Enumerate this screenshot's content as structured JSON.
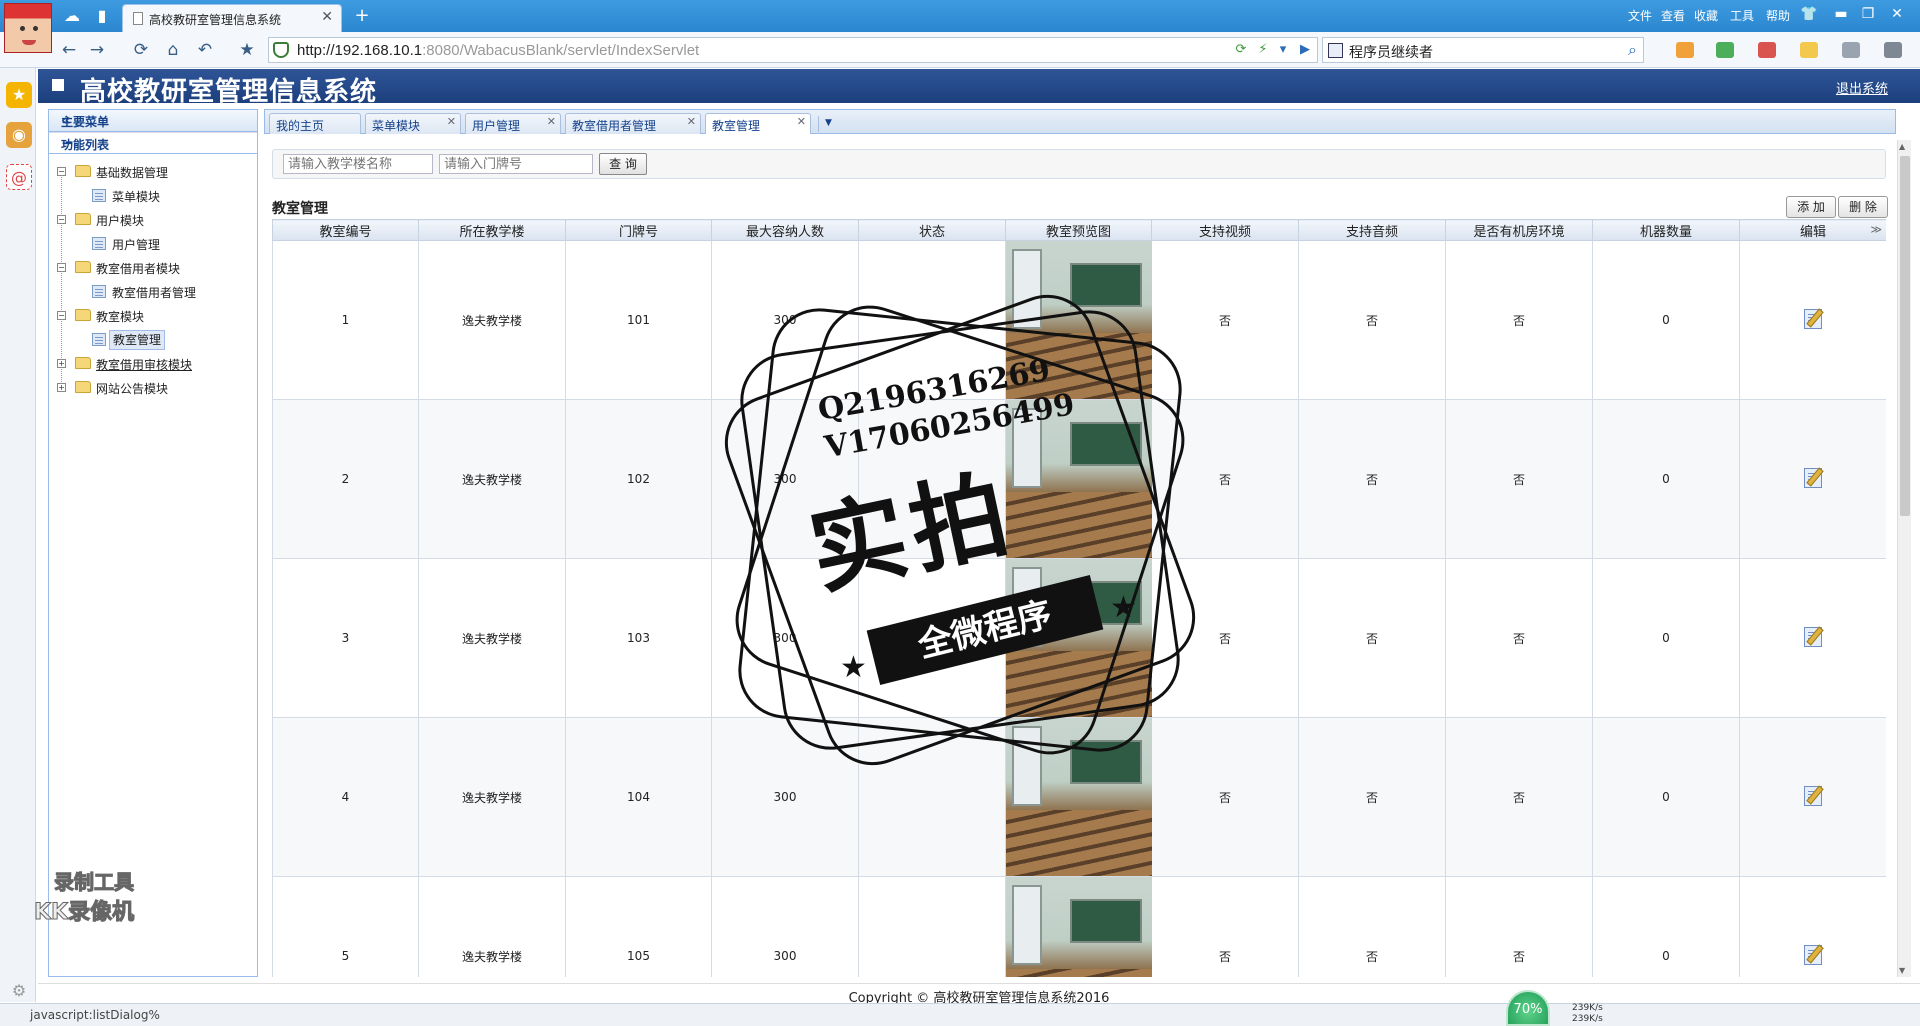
{
  "browser": {
    "tab_title": "高校教研室管理信息系统",
    "url_host": "http://192.168.10.1",
    "url_rest": ":8080/WabacusBlank/servlet/IndexServlet",
    "search_text": "程序员继续者",
    "menu": [
      "文件",
      "查看",
      "收藏",
      "工具",
      "帮助"
    ],
    "status_text": "javascript:listDialog%"
  },
  "app": {
    "title": "高校教研室管理信息系统",
    "logout": "退出系统",
    "footer": "Copyright © 高校教研室管理信息系统2016"
  },
  "sidebar": {
    "main_menu": "主要菜单",
    "function_list": "功能列表",
    "tree": [
      {
        "label": "基础数据管理",
        "level": 0,
        "expanded": true
      },
      {
        "label": "菜单模块",
        "level": 1
      },
      {
        "label": "用户模块",
        "level": 0,
        "expanded": true
      },
      {
        "label": "用户管理",
        "level": 1
      },
      {
        "label": "教室借用者模块",
        "level": 0,
        "expanded": true
      },
      {
        "label": "教室借用者管理",
        "level": 1
      },
      {
        "label": "教室模块",
        "level": 0,
        "expanded": true
      },
      {
        "label": "教室管理",
        "level": 1,
        "selected": true
      },
      {
        "label": "教室借用审核模块",
        "level": 0,
        "expanded": false
      },
      {
        "label": "网站公告模块",
        "level": 0,
        "expanded": false
      }
    ]
  },
  "tabs": [
    {
      "label": "我的主页",
      "closable": false
    },
    {
      "label": "菜单模块",
      "closable": true
    },
    {
      "label": "用户管理",
      "closable": true
    },
    {
      "label": "教室借用者管理",
      "closable": true
    },
    {
      "label": "教室管理",
      "closable": true,
      "active": true
    }
  ],
  "search": {
    "building_placeholder": "请输入教学楼名称",
    "room_placeholder": "请输入门牌号",
    "query_button": "查 询"
  },
  "section": {
    "title": "教室管理",
    "add_button": "添 加",
    "delete_button": "删 除"
  },
  "table": {
    "columns": [
      "教室编号",
      "所在教学楼",
      "门牌号",
      "最大容纳人数",
      "状态",
      "教室预览图",
      "支持视频",
      "支持音频",
      "是否有机房环境",
      "机器数量",
      "编辑"
    ],
    "rows": [
      {
        "id": "1",
        "building": "逸夫教学楼",
        "room": "101",
        "capacity": "300",
        "status": "",
        "video": "否",
        "audio": "否",
        "lab": "否",
        "machines": "0"
      },
      {
        "id": "2",
        "building": "逸夫教学楼",
        "room": "102",
        "capacity": "300",
        "status": "",
        "video": "否",
        "audio": "否",
        "lab": "否",
        "machines": "0"
      },
      {
        "id": "3",
        "building": "逸夫教学楼",
        "room": "103",
        "capacity": "300",
        "status": "",
        "video": "否",
        "audio": "否",
        "lab": "否",
        "machines": "0"
      },
      {
        "id": "4",
        "building": "逸夫教学楼",
        "room": "104",
        "capacity": "300",
        "status": "",
        "video": "否",
        "audio": "否",
        "lab": "否",
        "machines": "0"
      },
      {
        "id": "5",
        "building": "逸夫教学楼",
        "room": "105",
        "capacity": "300",
        "status": "",
        "video": "否",
        "audio": "否",
        "lab": "否",
        "machines": "0"
      }
    ]
  },
  "watermark": {
    "line1": "Q2196316269",
    "line2": "V17060256499",
    "big": "实拍",
    "ribbon": "全微程序",
    "kk1": "录制工具",
    "kk2": "KK录像机"
  },
  "tray": {
    "percent": "70%",
    "up": "239K/s",
    "down": "239K/s"
  }
}
